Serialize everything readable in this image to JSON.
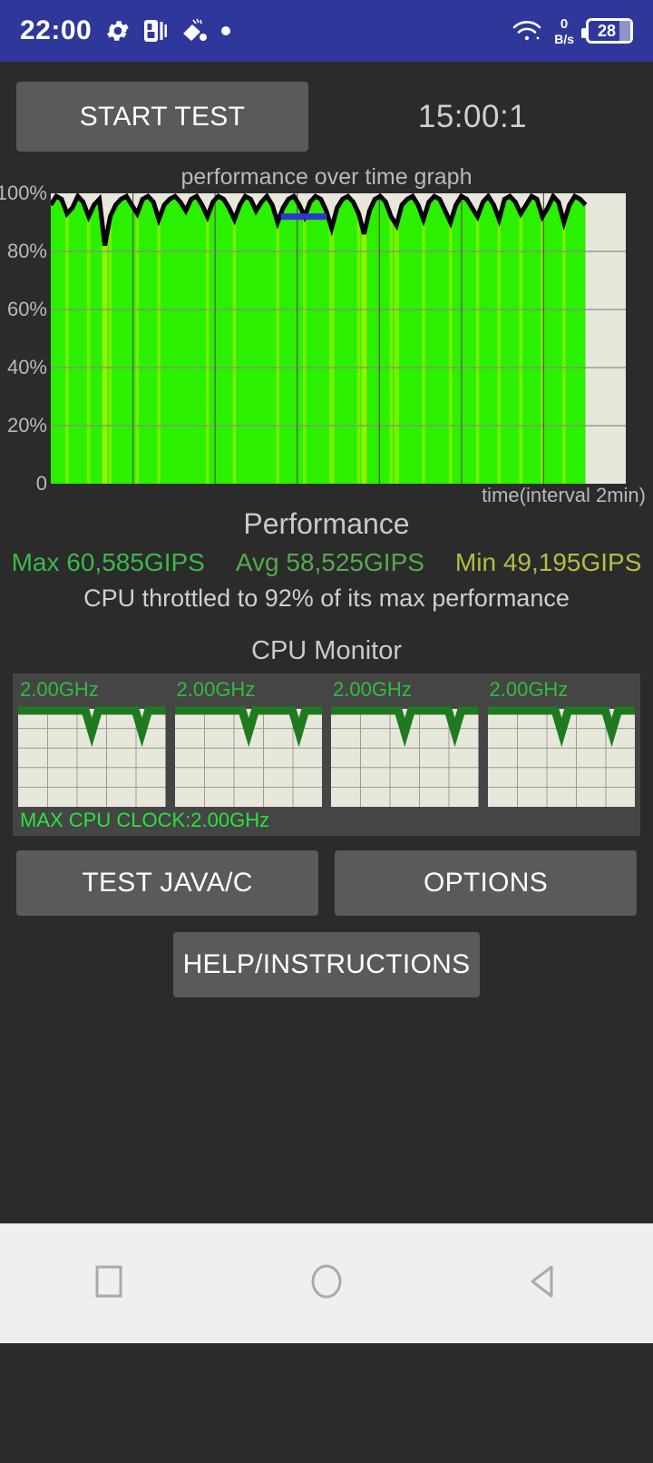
{
  "statusbar": {
    "clock": "22:00",
    "icons": [
      "gear-icon",
      "pip-icon",
      "brush-icon",
      "dot-icon"
    ],
    "net_speed_value": "0",
    "net_speed_unit": "B/s",
    "battery_level": "28",
    "wifi_icon": "wifi-icon"
  },
  "toolbar": {
    "start_test_label": "START TEST",
    "timer": "15:00:1"
  },
  "chart_data": {
    "type": "area",
    "title": "performance over time graph",
    "xlabel": "time(interval 2min)",
    "ylabel": "",
    "ylim": [
      0,
      100
    ],
    "xlim": [
      0,
      100
    ],
    "grid": true,
    "ytick_labels": [
      "100%",
      "80%",
      "60%",
      "40%",
      "20%",
      "0"
    ],
    "ytick_values": [
      100,
      80,
      60,
      40,
      20,
      0
    ],
    "marker_line": {
      "value": 92,
      "color": "#3434d0",
      "x_start": 40,
      "x_end": 48
    },
    "fill_color_high": "#2bf000",
    "fill_color_low": "#9bf000",
    "line_color": "#000000",
    "plot_bg": "#e8e7dc",
    "data_extent_pct": 93,
    "values": [
      96,
      99,
      98,
      93,
      95,
      99,
      97,
      92,
      96,
      98,
      82,
      92,
      96,
      98,
      99,
      96,
      93,
      98,
      99,
      97,
      91,
      96,
      98,
      99,
      97,
      94,
      98,
      99,
      96,
      92,
      97,
      99,
      98,
      95,
      91,
      96,
      99,
      98,
      94,
      97,
      99,
      96,
      90,
      95,
      98,
      99,
      96,
      92,
      97,
      99,
      98,
      94,
      88,
      95,
      98,
      99,
      97,
      93,
      86,
      94,
      98,
      99,
      97,
      92,
      89,
      96,
      98,
      99,
      96,
      91,
      97,
      99,
      98,
      94,
      90,
      96,
      99,
      98,
      95,
      92,
      97,
      99,
      96,
      91,
      98,
      99,
      97,
      93,
      96,
      99,
      98,
      92,
      95,
      99,
      97,
      90,
      96,
      99,
      98,
      96
    ]
  },
  "performance": {
    "title": "Performance",
    "max_label": "Max 60,585GIPS",
    "avg_label": "Avg 58,525GIPS",
    "min_label": "Min 49,195GIPS",
    "max_color": "#3cb84a",
    "avg_color": "#56a94e",
    "min_color": "#b6bd42",
    "throttle_text": "CPU throttled to 92% of its max performance"
  },
  "cpu_monitor": {
    "title": "CPU Monitor",
    "cores": [
      {
        "freq_label": "2.00GHz"
      },
      {
        "freq_label": "2.00GHz"
      },
      {
        "freq_label": "2.00GHz"
      },
      {
        "freq_label": "2.00GHz"
      }
    ],
    "max_clock_label": "MAX CPU CLOCK:2.00GHz",
    "core_graph_color": "#1f7a1f",
    "core_grid_bg": "#e8e7dc"
  },
  "buttons": {
    "test_java_c": "TEST JAVA/C",
    "options": "OPTIONS",
    "help_instructions": "HELP/INSTRUCTIONS"
  },
  "navbar": {
    "recents": "square-icon",
    "home": "circle-icon",
    "back": "triangle-left-icon"
  }
}
